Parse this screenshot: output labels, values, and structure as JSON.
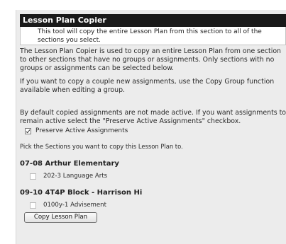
{
  "panel": {
    "title": "Lesson Plan Copier",
    "intro": "This tool will copy the entire Lesson Plan from this section to all of the sections you select."
  },
  "description": {
    "paragraph1": [
      "The Lesson Plan Copier is used to copy an entire Lesson Plan from one section",
      "to other sections that have no groups or assignments. Only sections with no",
      "groups or assignments can be selected below."
    ],
    "paragraph2": [
      "If you want to copy a couple new assignments, use the Copy Group function",
      "available when editing a group."
    ],
    "paragraph3": [
      "By default copied assignments are not made active. If you want assignments to",
      "remain active select the \"Preserve Active Assignments\" checkbox."
    ]
  },
  "preserve": {
    "label": "Preserve Active Assignments",
    "checked": true
  },
  "pick_text": "Pick the Sections you want to copy this Lesson Plan to.",
  "schools": [
    {
      "name": "07-08 Arthur Elementary",
      "sections": [
        {
          "label": "202-3 Language Arts",
          "checked": false
        }
      ]
    },
    {
      "name": "09-10 4T4P Block - Harrison Hi",
      "sections": [
        {
          "label": "0100y-1 Advisement",
          "checked": false
        }
      ]
    }
  ],
  "copy_button_label": "Copy Lesson Plan"
}
